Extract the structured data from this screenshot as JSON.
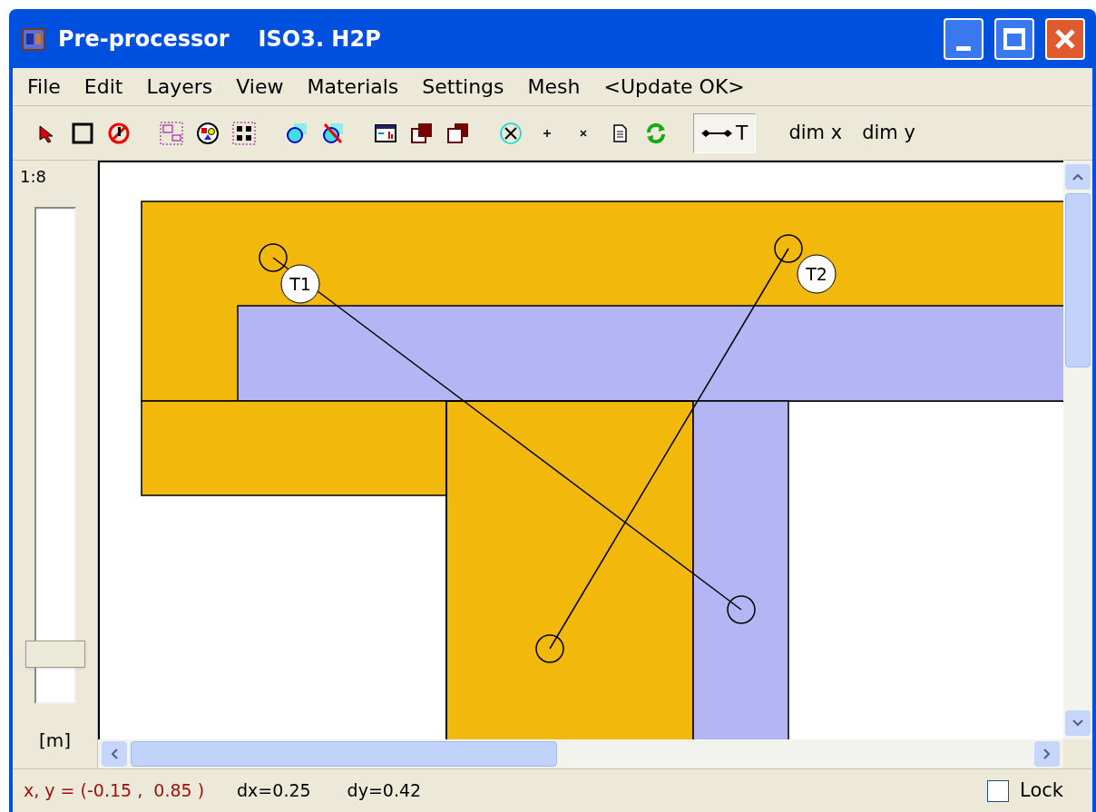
{
  "window": {
    "title": "Pre-processor",
    "file": "ISO3. H2P"
  },
  "menu": [
    "File",
    "Edit",
    "Layers",
    "View",
    "Materials",
    "Settings",
    "Mesh",
    "<Update OK>"
  ],
  "toolbar": {
    "dimension_tool": {
      "label": "T",
      "selected": true
    },
    "texts": [
      "dim x",
      "dim y"
    ]
  },
  "scale": {
    "ratio": "1:8",
    "unit": "[m]",
    "level": 0.1
  },
  "canvas": {
    "tags": [
      {
        "label": "T1"
      },
      {
        "label": "T2"
      }
    ]
  },
  "status_bar": {
    "coords": "x, y = (-0.15 ,  0.85 )",
    "dx": "dx=0.25",
    "dy": "dy=0.42",
    "lock": {
      "label": "Lock",
      "checked": false
    }
  }
}
